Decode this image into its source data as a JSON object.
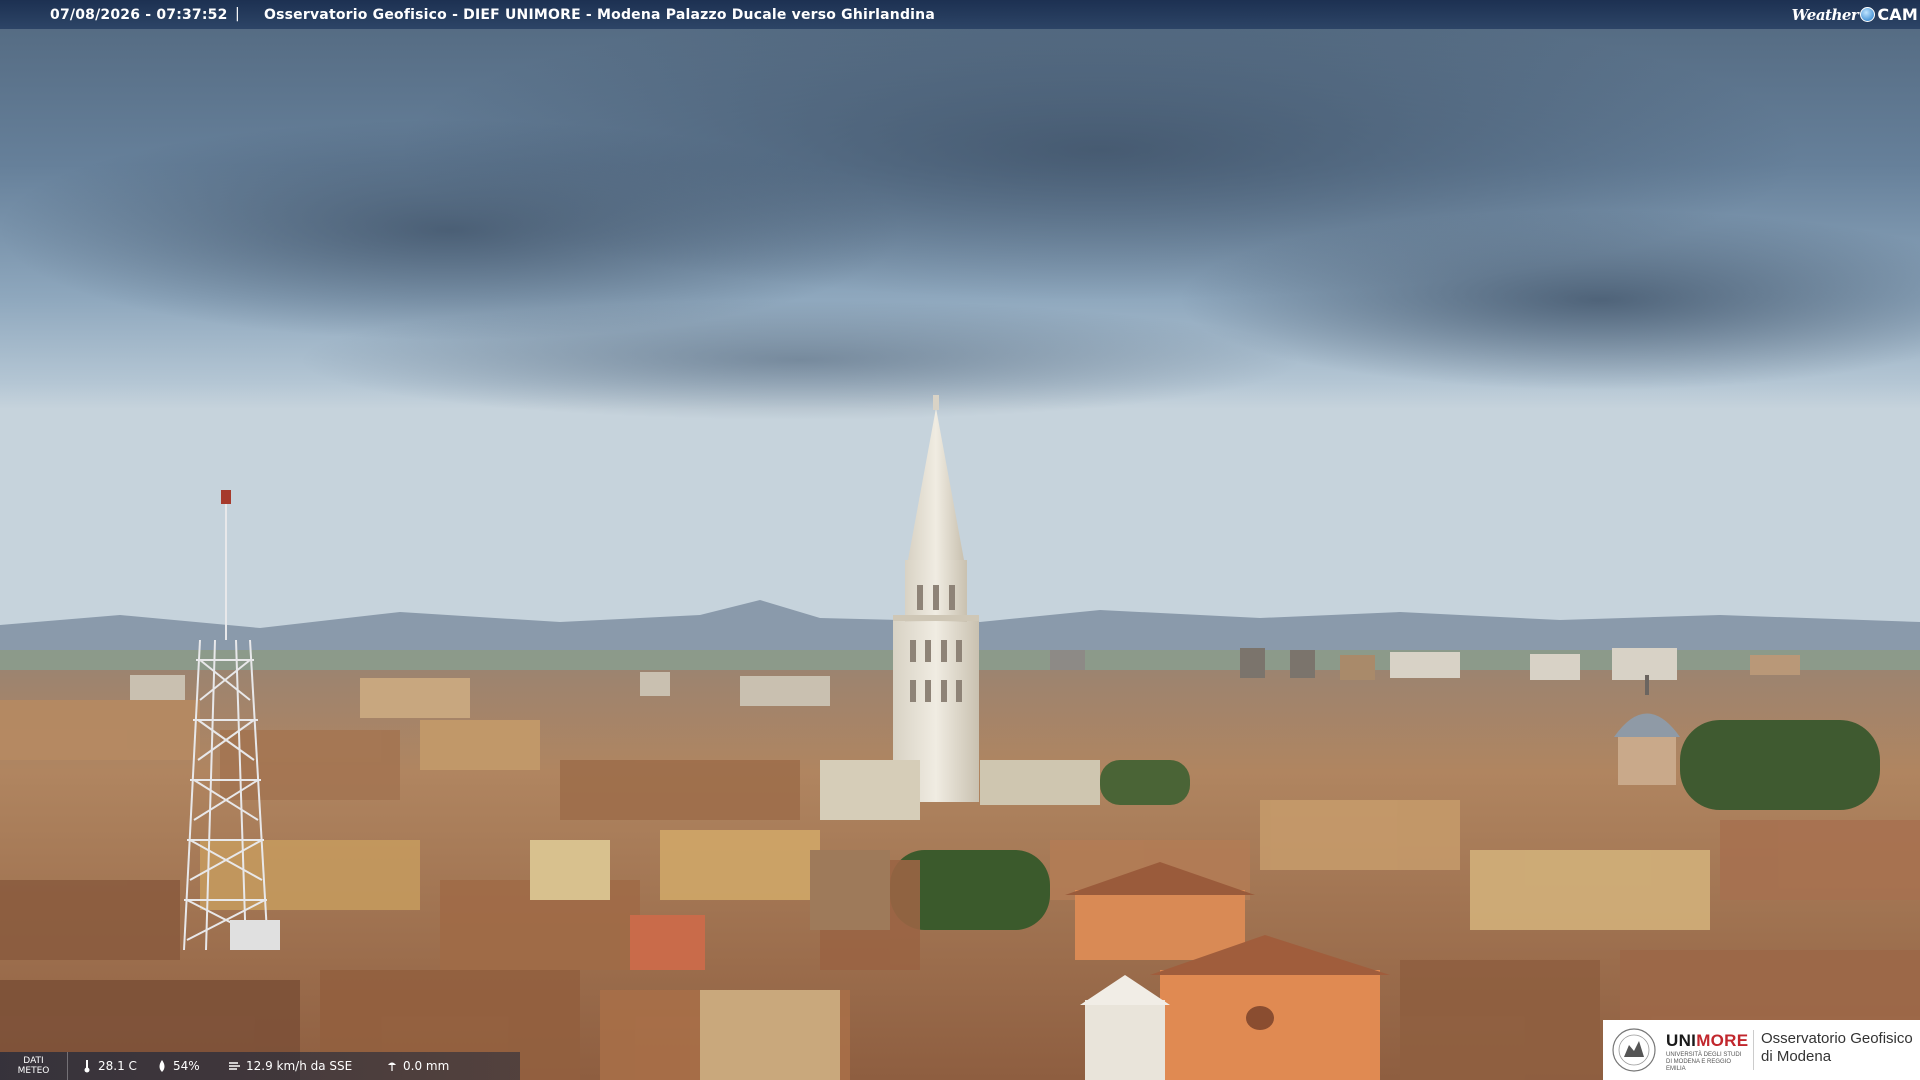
{
  "header": {
    "timestamp": "07/08/2026 - 07:37:52",
    "separator": "|",
    "title": "Osservatorio Geofisico - DIEF UNIMORE - Modena Palazzo Ducale verso Ghirlandina",
    "brand_part1": "Weather",
    "brand_part2": "CAM"
  },
  "meteo": {
    "label_line1": "DATI",
    "label_line2": "METEO",
    "temperature": "28.1 C",
    "humidity": "54%",
    "wind": "12.9 km/h da SSE",
    "rain": "0.0 mm"
  },
  "logo": {
    "uni": "UNI",
    "more": "MORE",
    "sub": "UNIVERSITÀ DEGLI STUDI DI MODENA E REGGIO EMILIA",
    "obs_line1": "Osservatorio Geofisico",
    "obs_line2": "di Modena"
  },
  "colors": {
    "sky_top": "#4d6781",
    "sky_horizon": "#b9c9d6",
    "roof": "#a8714c",
    "tower": "#e8e3d6",
    "accent_red": "#c1272d"
  },
  "icons": [
    "thermometer-icon",
    "humidity-icon",
    "wind-icon",
    "rain-icon",
    "university-seal-icon",
    "weathercam-dot-icon"
  ]
}
